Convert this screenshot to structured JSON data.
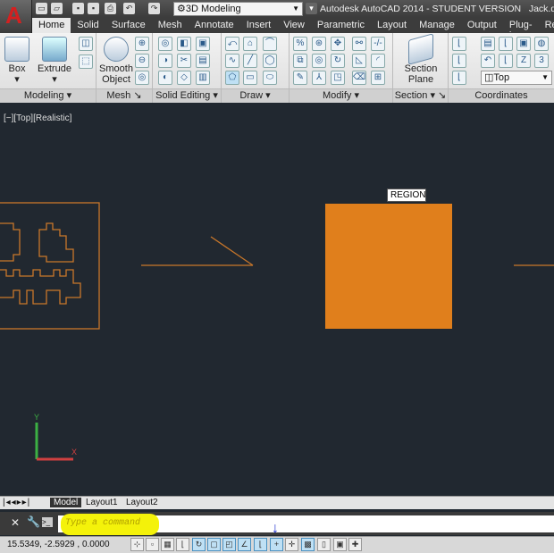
{
  "title_bar": {
    "workspace": "3D Modeling",
    "title": "Autodesk AutoCAD 2014 - STUDENT VERSION",
    "file": "Jack.dwg"
  },
  "tabs": [
    "Home",
    "Solid",
    "Surface",
    "Mesh",
    "Annotate",
    "Insert",
    "View",
    "Parametric",
    "Layout",
    "Manage",
    "Output",
    "Plug-ins",
    "Ren"
  ],
  "active_tab": "Home",
  "ribbon": {
    "modeling": {
      "label": "Modeling",
      "box": "Box",
      "extrude": "Extrude"
    },
    "mesh": {
      "label": "Mesh",
      "smooth": "Smooth",
      "object": "Object"
    },
    "solid_editing": {
      "label": "Solid Editing"
    },
    "draw": {
      "label": "Draw"
    },
    "modify": {
      "label": "Modify"
    },
    "section": {
      "label": "Section",
      "btn1": "Section",
      "btn2": "Plane"
    },
    "coordinates": {
      "label": "Coordinates",
      "view": "Top"
    }
  },
  "viewport": {
    "label": "[−][Top][Realistic]",
    "tooltip": "REGION",
    "object_color": "#e07f1c",
    "background": "#212830"
  },
  "layout_tabs": [
    "Model",
    "Layout1",
    "Layout2"
  ],
  "command": {
    "placeholder": "Type a command"
  },
  "status": {
    "coords": "15.5349, -2.5929 , 0.0000"
  }
}
